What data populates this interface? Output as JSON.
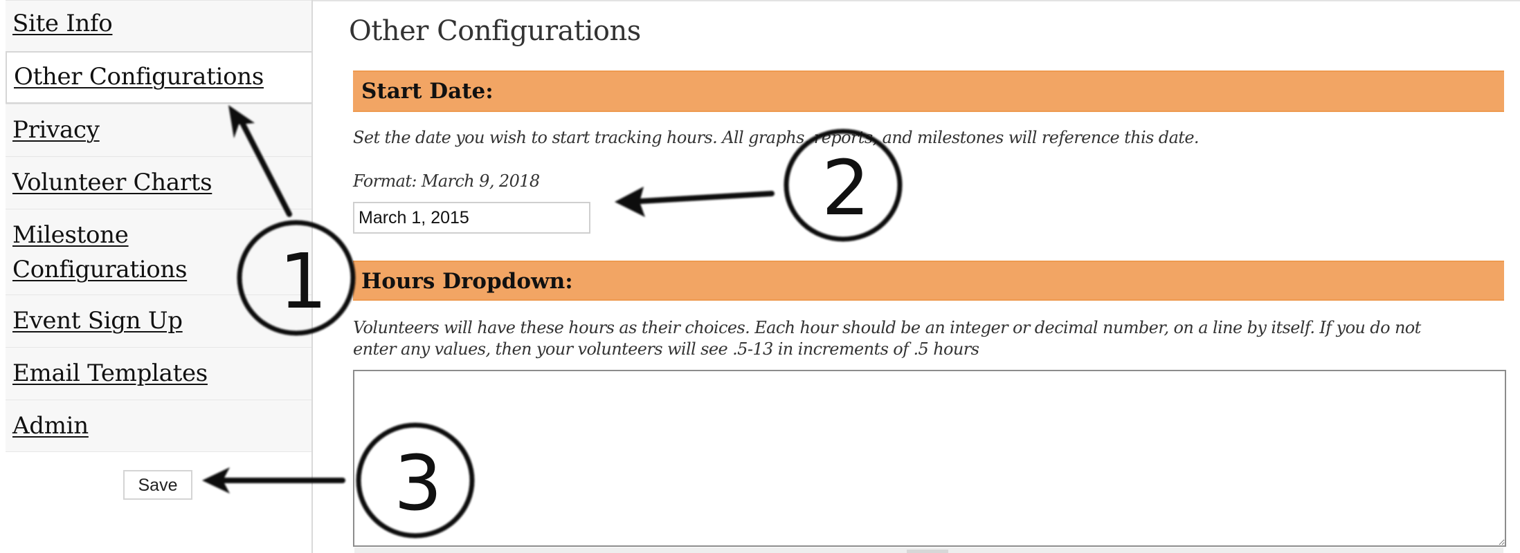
{
  "sidebar": {
    "items": [
      {
        "label": "Site Info",
        "active": false
      },
      {
        "label": "Other Configurations",
        "active": true
      },
      {
        "label": "Privacy",
        "active": false
      },
      {
        "label": "Volunteer Charts",
        "active": false
      },
      {
        "label": "Milestone Configurations",
        "line1": "Milestone",
        "line2": "Configurations",
        "active": false
      },
      {
        "label": "Event Sign Up",
        "active": false
      },
      {
        "label": "Email Templates",
        "active": false
      },
      {
        "label": "Admin",
        "active": false
      }
    ],
    "save_label": "Save"
  },
  "main": {
    "title": "Other Configurations",
    "start_date": {
      "heading": "Start Date:",
      "description": "Set the date you wish to start tracking hours. All graphs, reports, and milestones will reference this date.",
      "format_hint": "Format: March 9, 2018",
      "value": "March 1, 2015"
    },
    "hours_dropdown": {
      "heading": "Hours Dropdown:",
      "description_line1": "Volunteers will have these hours as their choices. Each hour should be an integer or decimal number, on a line by itself. If you do not",
      "description_line2": "enter any values, then your volunteers will see .5-13 in increments of .5 hours",
      "value": ""
    }
  },
  "annotations": [
    {
      "number": "1",
      "target": "Other Configurations tab"
    },
    {
      "number": "2",
      "target": "Start date input"
    },
    {
      "number": "3",
      "target": "Save button"
    }
  ],
  "colors": {
    "section_band": "#f2a564",
    "sidebar_bg": "#f7f7f7"
  }
}
